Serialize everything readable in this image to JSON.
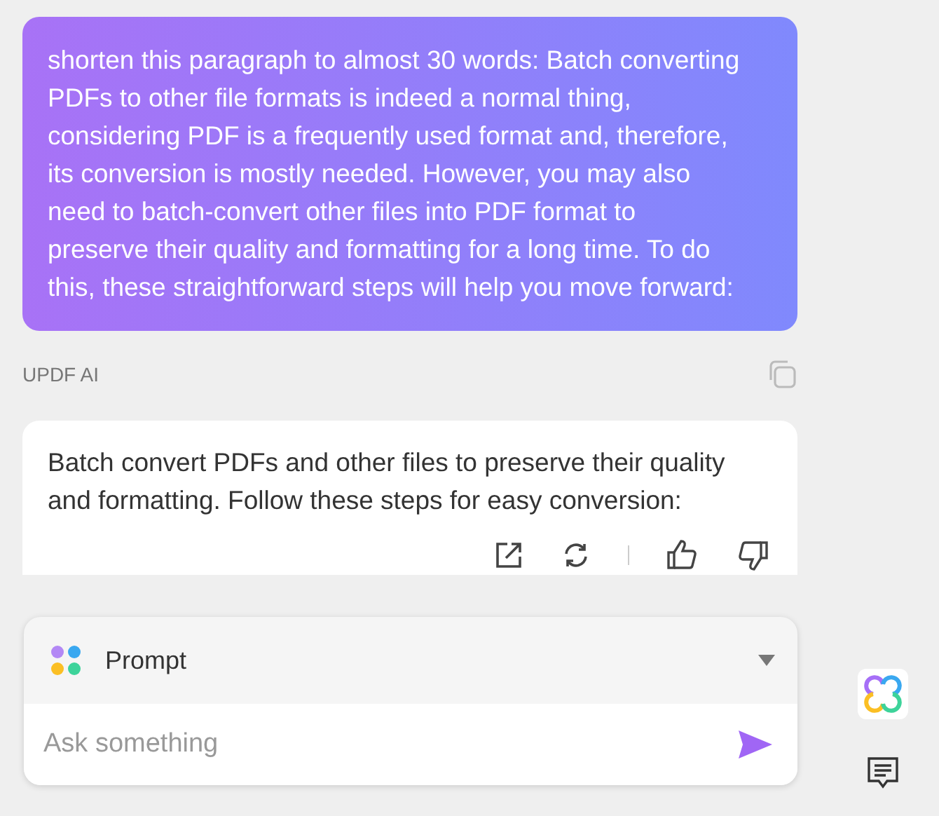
{
  "user_message": "shorten this paragraph to almost 30 words: Batch converting PDFs to other file formats is indeed a normal thing, considering PDF is a frequently used format and, therefore, its conversion is mostly needed. However, you may also need to batch-convert other files into PDF format to preserve their quality and formatting for a long time. To do this, these straightforward steps will help you move forward:",
  "assistant": {
    "name": "UPDF AI",
    "message": "Batch convert PDFs and other files to preserve their quality and formatting. Follow these steps for easy conversion:"
  },
  "composer": {
    "mode": "Prompt",
    "placeholder": "Ask something"
  }
}
